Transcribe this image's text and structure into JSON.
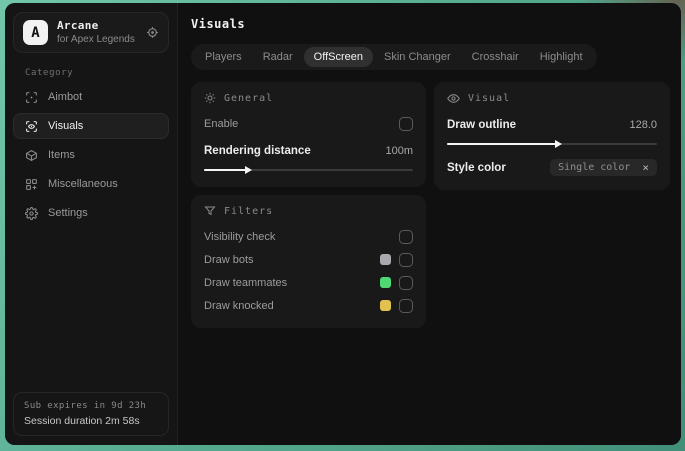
{
  "brand": {
    "initial": "A",
    "name": "Arcane",
    "subtitle": "for Apex Legends"
  },
  "sidebar": {
    "category_label": "Category",
    "items": [
      {
        "label": "Aimbot",
        "icon": "aimbot-icon",
        "active": false
      },
      {
        "label": "Visuals",
        "icon": "visuals-icon",
        "active": true
      },
      {
        "label": "Items",
        "icon": "items-icon",
        "active": false
      },
      {
        "label": "Miscellaneous",
        "icon": "miscellaneous-icon",
        "active": false
      },
      {
        "label": "Settings",
        "icon": "settings-icon",
        "active": false
      }
    ],
    "session": {
      "expires": "Sub expires in 9d 23h",
      "duration": "Session duration 2m 58s"
    }
  },
  "header": {
    "title": "Visuals"
  },
  "tabs": [
    {
      "label": "Players",
      "active": false
    },
    {
      "label": "Radar",
      "active": false
    },
    {
      "label": "OffScreen",
      "active": true
    },
    {
      "label": "Skin Changer",
      "active": false
    },
    {
      "label": "Crosshair",
      "active": false
    },
    {
      "label": "Highlight",
      "active": false
    }
  ],
  "panels": {
    "general": {
      "title": "General",
      "enable_label": "Enable",
      "enable_checked": false,
      "rendering_distance": {
        "label": "Rendering distance",
        "value": "100m",
        "fill_percent": 20
      }
    },
    "visual": {
      "title": "Visual",
      "draw_outline": {
        "label": "Draw outline",
        "value": "128.0",
        "fill_percent": 52
      },
      "style_color": {
        "label": "Style color",
        "selected": "Single color",
        "clear_glyph": "×"
      }
    },
    "filters": {
      "title": "Filters",
      "rows": [
        {
          "label": "Visibility check",
          "swatch": null,
          "checked": false
        },
        {
          "label": "Draw bots",
          "swatch": "#a9a9ae",
          "checked": false
        },
        {
          "label": "Draw teammates",
          "swatch": "#4fd873",
          "checked": false
        },
        {
          "label": "Draw knocked",
          "swatch": "#e2c24f",
          "checked": false
        }
      ]
    }
  },
  "colors": {
    "backdrop_teal": "#58ac91",
    "window_bg": "#101010",
    "sidebar_bg": "#151515",
    "panel_bg": "#191919",
    "accent_text": "#ececec",
    "muted_text": "#9c9c9c"
  }
}
